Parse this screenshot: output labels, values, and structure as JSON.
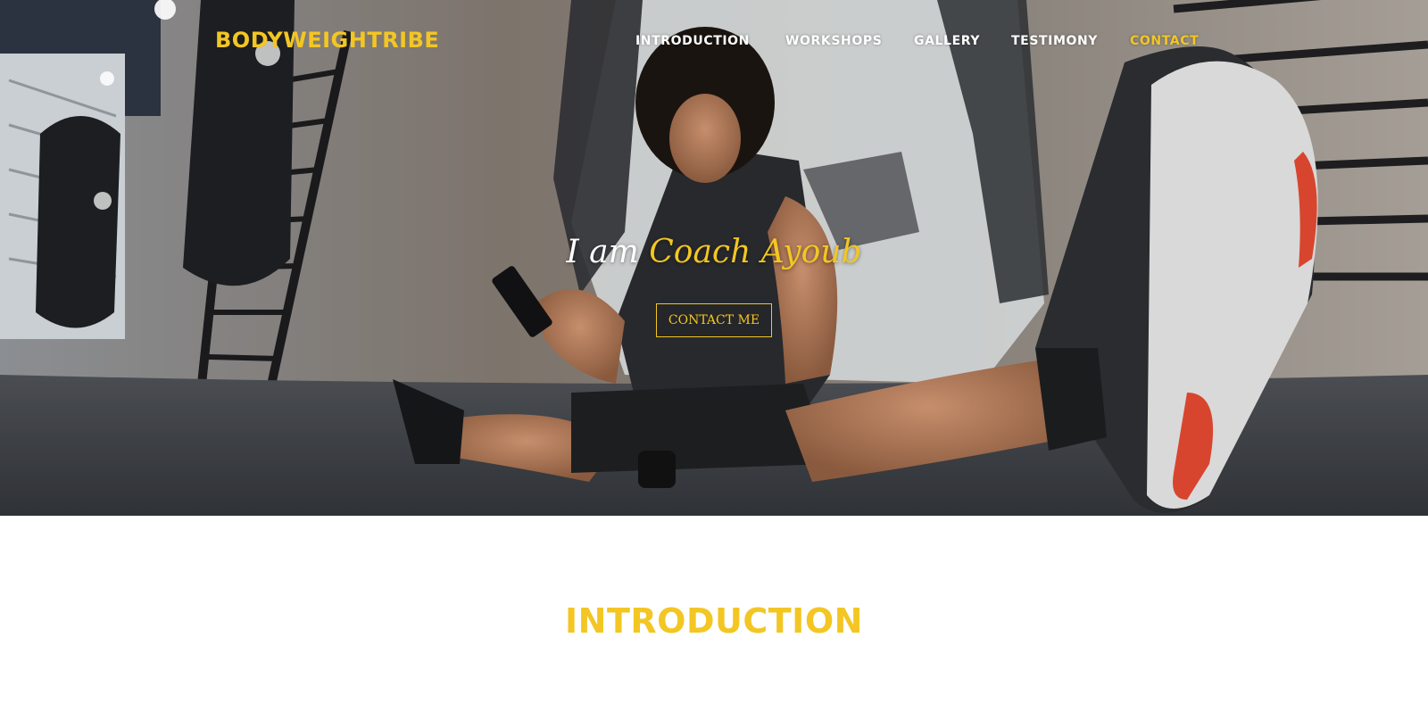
{
  "brand": {
    "name": "BODYWEIGHTRIBE"
  },
  "nav": {
    "items": [
      {
        "label": "INTRODUCTION"
      },
      {
        "label": "WORKSHOPS"
      },
      {
        "label": "GALLERY"
      },
      {
        "label": "TESTIMONY"
      },
      {
        "label": "CONTACT"
      }
    ]
  },
  "hero": {
    "title_prefix": "I am",
    "title_name": "Coach Ayoub",
    "button_label": "CONTACT ME"
  },
  "intro": {
    "heading": "INTRODUCTION"
  },
  "colors": {
    "accent": "#f3c623",
    "nav_text": "#ffffff"
  }
}
